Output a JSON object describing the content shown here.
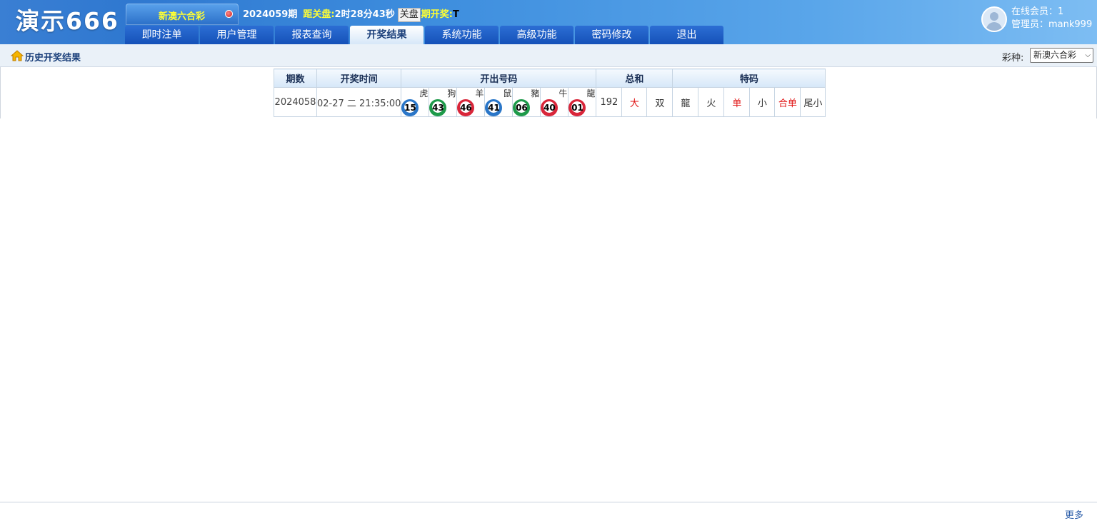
{
  "header": {
    "brand": "演示666",
    "lottery_name": "新澳六合彩",
    "period_label": "2024059期",
    "countdown_label": "距关盘:",
    "countdown": "2时28分43秒",
    "close_button": "关盘",
    "open_label": "期开奖:",
    "open_value": "T",
    "nav": [
      {
        "label": "即时注单",
        "active": false
      },
      {
        "label": "用户管理",
        "active": false
      },
      {
        "label": "报表查询",
        "active": false
      },
      {
        "label": "开奖结果",
        "active": true
      },
      {
        "label": "系统功能",
        "active": false
      },
      {
        "label": "高级功能",
        "active": false
      },
      {
        "label": "密码修改",
        "active": false
      },
      {
        "label": "退出",
        "active": false
      }
    ],
    "online_members": "在线会员：1",
    "admin": "管理员：mank999"
  },
  "subbar": {
    "crumb": "历史开奖结果",
    "type_label": "彩种:",
    "type_selected": "新澳六合彩"
  },
  "table": {
    "headers": {
      "period": "期数",
      "time": "开奖时间",
      "numbers": "开出号码",
      "sum": "总和",
      "special": "特码"
    },
    "rows": [
      {
        "period": "2024058",
        "time": "02-27 二 21:35:00",
        "balls": [
          {
            "num": "15",
            "zodiac": "虎",
            "color": "#2a76c8"
          },
          {
            "num": "43",
            "zodiac": "狗",
            "color": "#1e9a4a"
          },
          {
            "num": "46",
            "zodiac": "羊",
            "color": "#d8263a"
          },
          {
            "num": "41",
            "zodiac": "鼠",
            "color": "#2a76c8"
          },
          {
            "num": "06",
            "zodiac": "豬",
            "color": "#1e9a4a"
          },
          {
            "num": "40",
            "zodiac": "牛",
            "color": "#d8263a"
          },
          {
            "num": "01",
            "zodiac": "龍",
            "color": "#d8263a"
          }
        ],
        "sum": [
          {
            "text": "192",
            "red": false
          },
          {
            "text": "大",
            "red": true
          },
          {
            "text": "双",
            "red": false
          }
        ],
        "special": [
          {
            "text": "龍",
            "red": false
          },
          {
            "text": "火",
            "red": false
          },
          {
            "text": "单",
            "red": true
          },
          {
            "text": "小",
            "red": false
          },
          {
            "text": "合单",
            "red": true
          },
          {
            "text": "尾小",
            "red": false
          }
        ]
      }
    ]
  },
  "footer": {
    "more": "更多"
  }
}
